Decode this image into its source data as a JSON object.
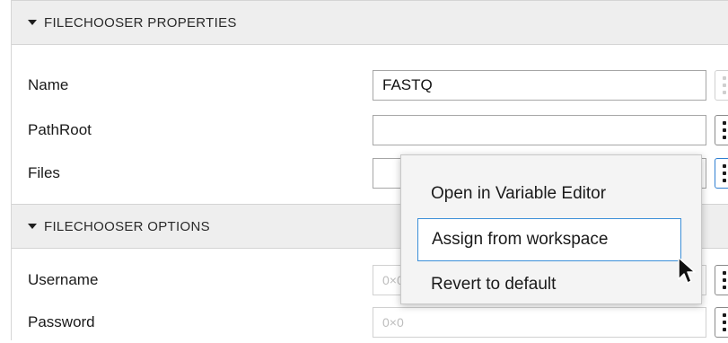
{
  "sections": {
    "properties": {
      "title": "FILECHOOSER PROPERTIES"
    },
    "options": {
      "title": "FILECHOOSER OPTIONS"
    }
  },
  "fields": {
    "name": {
      "label": "Name",
      "value": "FASTQ"
    },
    "pathroot": {
      "label": "PathRoot",
      "value": ""
    },
    "files": {
      "label": "Files",
      "value": ""
    },
    "username": {
      "label": "Username",
      "value": "0×0"
    },
    "password": {
      "label": "Password",
      "value": "0×0"
    }
  },
  "context_menu": {
    "items": [
      {
        "label": "Open in Variable Editor"
      },
      {
        "label": "Assign from workspace"
      },
      {
        "label": "Revert to default"
      }
    ],
    "hovered_index": 1
  },
  "colors": {
    "header_bg": "#eeeeee",
    "accent": "#3c8fd8",
    "menu_bg": "#f4f4f4"
  },
  "icons": {
    "section_toggle": "triangle-down-icon",
    "more_options": "vertical-ellipsis-icon",
    "cursor": "mouse-pointer-icon"
  }
}
